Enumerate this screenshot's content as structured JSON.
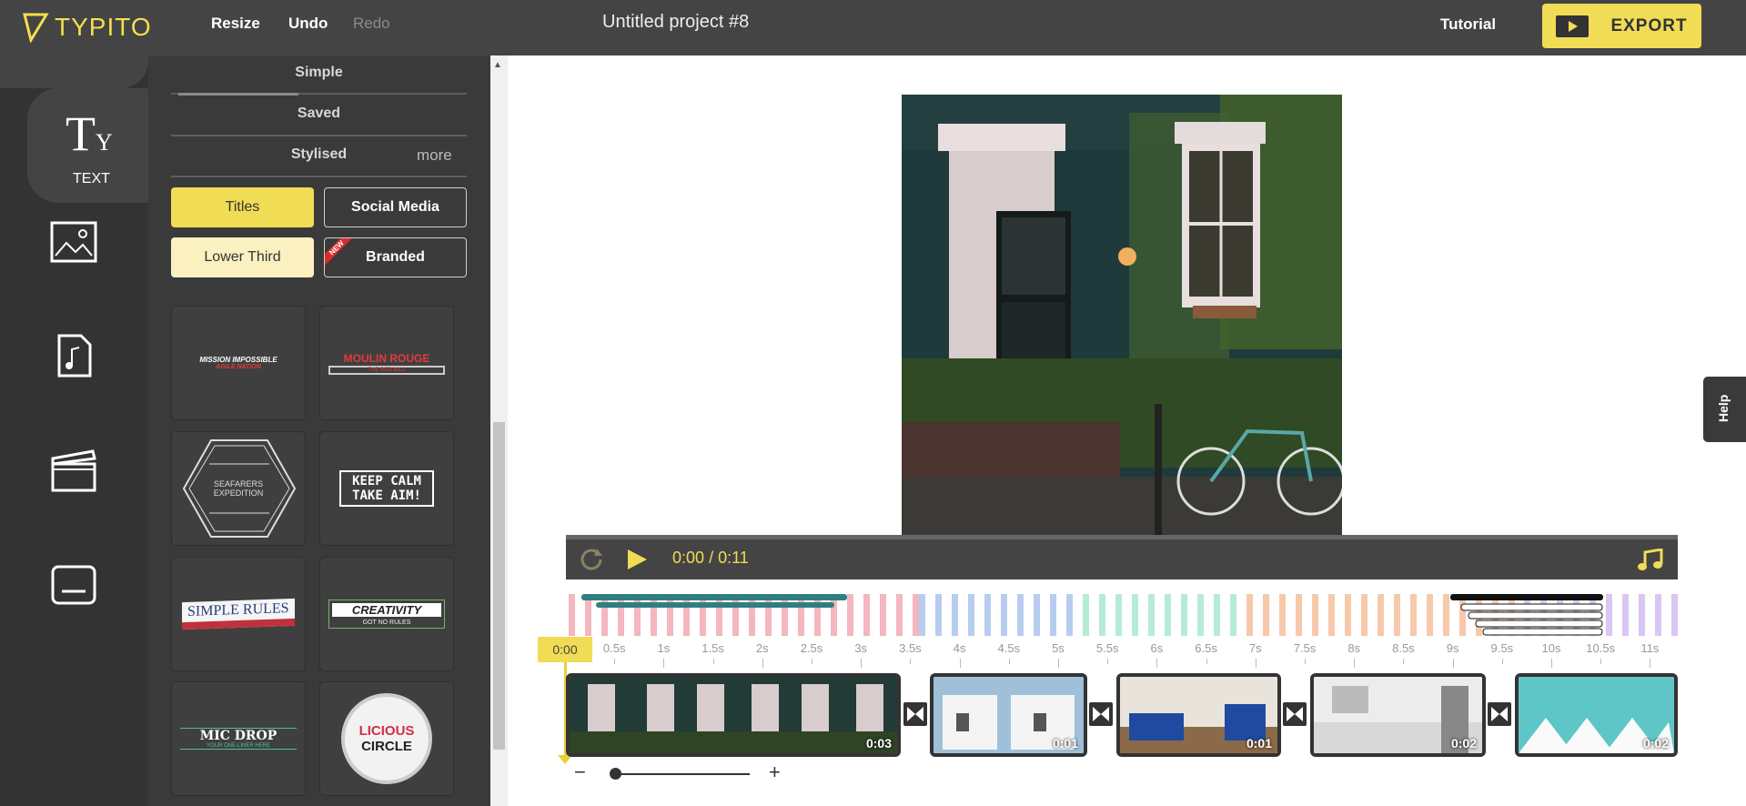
{
  "topbar": {
    "logo_text": "TYPITO",
    "resize_label": "Resize",
    "undo_label": "Undo",
    "redo_label": "Redo",
    "project_title": "Untitled project #8",
    "tutorial_label": "Tutorial",
    "export_label": "EXPORT"
  },
  "rail": {
    "text_label": "TEXT",
    "items": [
      {
        "icon": "text-icon",
        "label": "TEXT"
      },
      {
        "icon": "image-icon"
      },
      {
        "icon": "music-file-icon"
      },
      {
        "icon": "clapperboard-icon"
      },
      {
        "icon": "subtitle-icon"
      }
    ]
  },
  "panel": {
    "tabs": [
      "Simple",
      "Saved",
      "Stylised"
    ],
    "more_label": "more",
    "chips": [
      "Titles",
      "Social Media",
      "Lower Third",
      "Branded"
    ],
    "new_badge": "NEW",
    "templates": [
      {
        "line1": "MISSION IMPOSSIBLE",
        "line2": "AGILE NATION"
      },
      {
        "line1": "MOULIN ROUGE",
        "line2": "THE RED MILL"
      },
      {
        "line1": "SEAFARERS",
        "line2": "EXPEDITION"
      },
      {
        "line1": "KEEP CALM",
        "line2": "TAKE AIM!"
      },
      {
        "line1": "SIMPLE RULES",
        "line2": ""
      },
      {
        "line1": "CREATIVITY",
        "line2": "GOT NO RULES"
      },
      {
        "line1": "MIC DROP",
        "line2": "YOUR ONE-LINER HERE"
      },
      {
        "line1": "LICIOUS",
        "line2": "CIRCLE"
      }
    ]
  },
  "player": {
    "current_time": "0:00",
    "separator": "/",
    "total_time": "0:11"
  },
  "timeline": {
    "playhead_label": "0:00",
    "ticks": [
      "0.5s",
      "1s",
      "1.5s",
      "2s",
      "2.5s",
      "3s",
      "3.5s",
      "4s",
      "4.5s",
      "5s",
      "5.5s",
      "6s",
      "6.5s",
      "7s",
      "7.5s",
      "8s",
      "8.5s",
      "9s",
      "9.5s",
      "10s",
      "10.5s",
      "11s"
    ],
    "clips": [
      {
        "duration": "0:03"
      },
      {
        "duration": "0:01"
      },
      {
        "duration": "0:01"
      },
      {
        "duration": "0:02"
      },
      {
        "duration": "0:02"
      }
    ],
    "zoom_minus": "−",
    "zoom_plus": "+"
  },
  "help_label": "Help",
  "colors": {
    "accent": "#f1dc55",
    "topbar": "#444444",
    "rail": "#333333",
    "panel": "#3a3a3a"
  }
}
